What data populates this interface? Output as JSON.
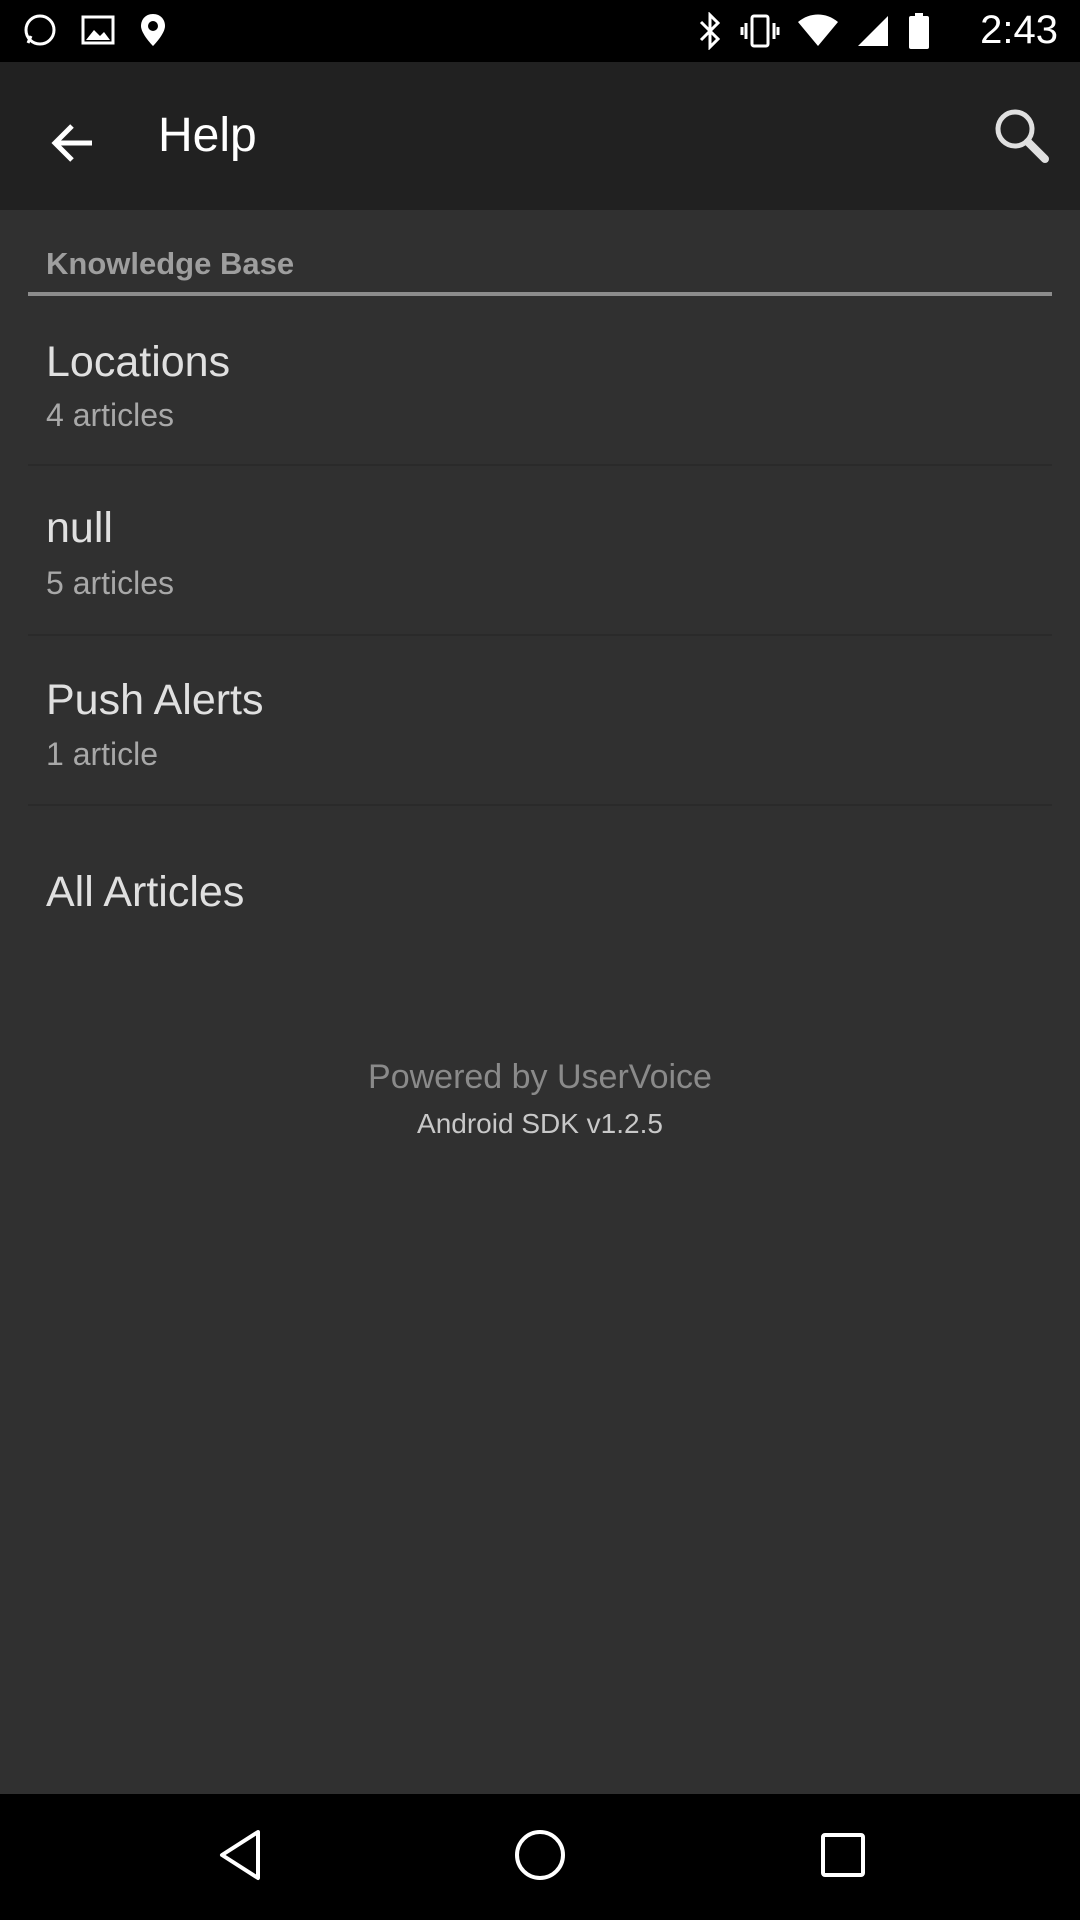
{
  "status_bar": {
    "time": "2:43",
    "icons": [
      "whatsapp-icon",
      "image-icon",
      "location-icon",
      "bluetooth-icon",
      "vibrate-icon",
      "wifi-icon",
      "signal-icon",
      "battery-icon"
    ]
  },
  "app_bar": {
    "title": "Help",
    "back_icon": "arrow-back-icon",
    "search_icon": "search-icon"
  },
  "section": {
    "header": "Knowledge Base"
  },
  "topics": [
    {
      "title": "Locations",
      "subtitle": "4 articles"
    },
    {
      "title": "null",
      "subtitle": "5 articles"
    },
    {
      "title": "Push Alerts",
      "subtitle": "1 article"
    }
  ],
  "all_articles": "All Articles",
  "footer": {
    "powered_by": "Powered by UserVoice",
    "sdk_version": "Android SDK v1.2.5"
  },
  "nav_bar": {
    "back_icon": "nav-back-icon",
    "home_icon": "nav-home-icon",
    "recents_icon": "nav-recents-icon"
  },
  "colors": {
    "background": "#303030",
    "app_bar": "#212121",
    "text_primary": "#e0e0e0",
    "text_secondary": "#a8a8a8"
  }
}
